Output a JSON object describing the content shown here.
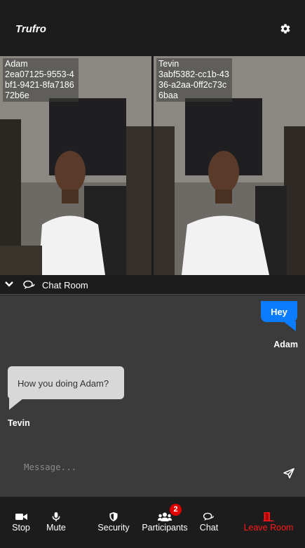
{
  "app": {
    "brand": "Trufro"
  },
  "videos": [
    {
      "name": "Adam",
      "id": "2ea07125-9553-4bf1-9421-8fa718672b6e"
    },
    {
      "name": "Tevin",
      "id": "3abf5382-cc1b-4336-a2aa-0ff2c73c6baa"
    }
  ],
  "chat": {
    "title": "Chat Room",
    "messages": [
      {
        "text": "Hey",
        "sender": "Adam",
        "direction": "outgoing"
      },
      {
        "text": "How you doing Adam?",
        "sender": "Tevin",
        "direction": "incoming"
      }
    ],
    "input": {
      "placeholder": "Message...",
      "value": ""
    }
  },
  "toolbar": {
    "stop": "Stop",
    "mute": "Mute",
    "security": "Security",
    "participants": "Participants",
    "participants_count": "2",
    "chat": "Chat",
    "leave": "Leave Room"
  },
  "colors": {
    "background": "#1c1c1c",
    "chat_panel": "#3b3b3b",
    "outgoing_bubble": "#0b7bff",
    "incoming_bubble": "#d8d8d8",
    "leave": "#ff1a1a",
    "badge": "#e00000"
  },
  "icons": [
    "gear-icon",
    "chevron-down-icon",
    "chat-room-icon",
    "send-icon",
    "video-camera-icon",
    "microphone-icon",
    "shield-icon",
    "users-icon",
    "chat-icon",
    "exit-door-icon"
  ]
}
